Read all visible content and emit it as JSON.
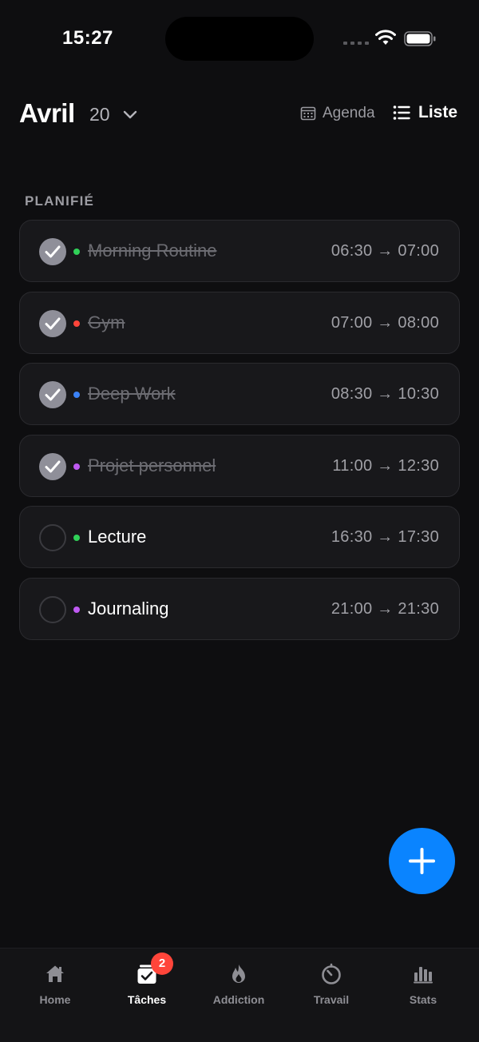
{
  "status_bar": {
    "time": "15:27"
  },
  "header": {
    "month": "Avril",
    "day": "20",
    "views": {
      "agenda": "Agenda",
      "liste": "Liste",
      "active": "liste"
    }
  },
  "section": {
    "label": "PLANIFIÉ"
  },
  "tasks": [
    {
      "title": "Morning Routine",
      "time": "06:30 → 07:00",
      "done": true,
      "color": "#30d158"
    },
    {
      "title": "Gym",
      "time": "07:00 → 08:00",
      "done": true,
      "color": "#ff453a"
    },
    {
      "title": "Deep Work",
      "time": "08:30 → 10:30",
      "done": true,
      "color": "#3b82f6"
    },
    {
      "title": "Projet personnel",
      "time": "11:00 → 12:30",
      "done": true,
      "color": "#bf5af2"
    },
    {
      "title": "Lecture",
      "time": "16:30 → 17:30",
      "done": false,
      "color": "#30d158"
    },
    {
      "title": "Journaling",
      "time": "21:00 → 21:30",
      "done": false,
      "color": "#bf5af2"
    }
  ],
  "fab": {
    "icon": "plus-icon",
    "color": "#0a84ff"
  },
  "tab_bar": {
    "tabs": [
      {
        "label": "Home",
        "icon": "home-icon"
      },
      {
        "label": "Tâches",
        "icon": "tasks-icon",
        "badge": "2",
        "active": true
      },
      {
        "label": "Addiction",
        "icon": "flame-icon"
      },
      {
        "label": "Travail",
        "icon": "timer-icon"
      },
      {
        "label": "Stats",
        "icon": "bar-chart-icon"
      }
    ]
  }
}
